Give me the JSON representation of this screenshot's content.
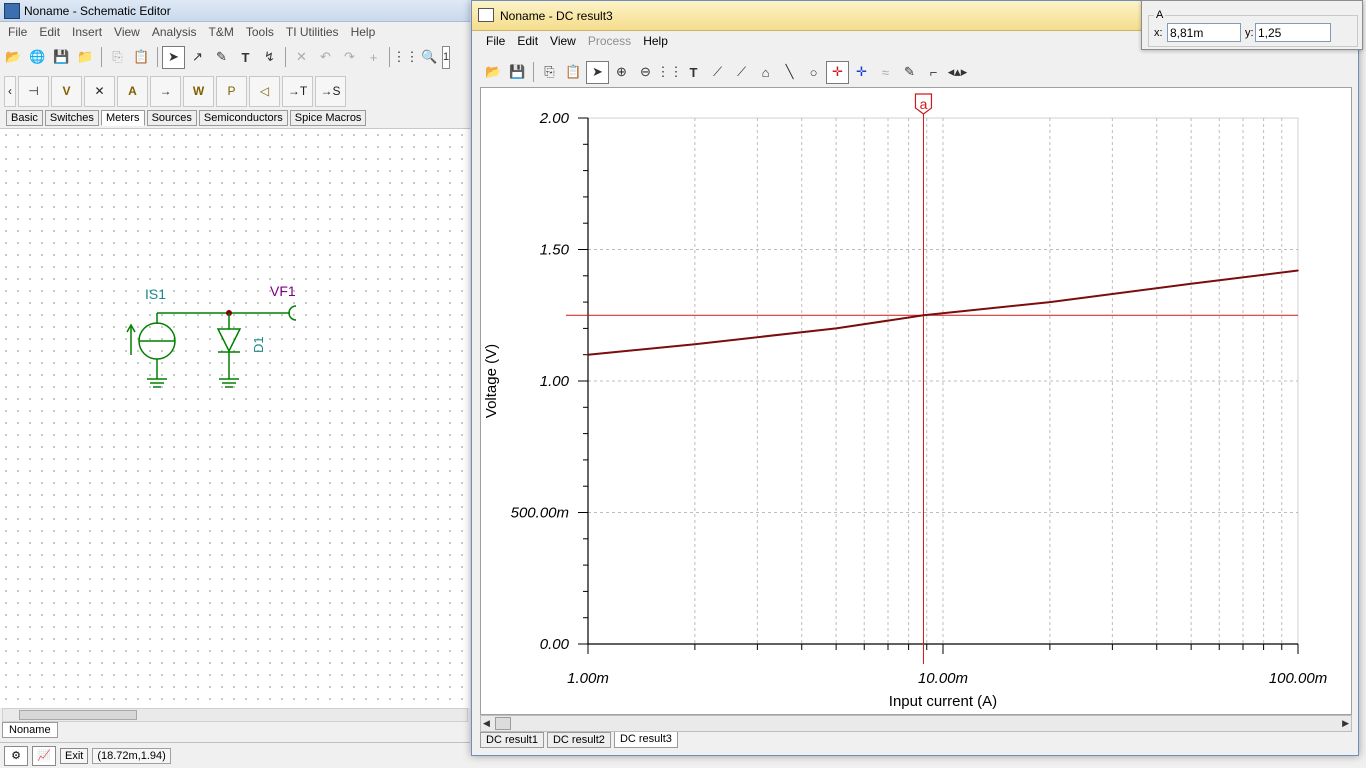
{
  "schematic": {
    "title": "Noname - Schematic Editor",
    "menu": [
      "File",
      "Edit",
      "Insert",
      "View",
      "Analysis",
      "T&M",
      "Tools",
      "TI Utilities",
      "Help"
    ],
    "zoom_partial": "1",
    "component_tabs": [
      {
        "label": "Basic",
        "selected": false
      },
      {
        "label": "Switches",
        "selected": false
      },
      {
        "label": "Meters",
        "selected": true
      },
      {
        "label": "Sources",
        "selected": false
      },
      {
        "label": "Semiconductors",
        "selected": false
      },
      {
        "label": "Spice Macros",
        "selected": false
      }
    ],
    "meter_buttons": [
      "⊣",
      "V",
      "✕",
      "A",
      "→",
      "W",
      "P",
      "◁",
      "→T",
      "→S"
    ],
    "circuit": {
      "source_label": "IS1",
      "diode_label": "D1",
      "probe_label": "VF1",
      "wire_color": "#008000",
      "label_color_source": "#1a8a8a",
      "label_color_probe": "#800080"
    },
    "doc_tab": "Noname",
    "status": {
      "exit_label": "Exit",
      "coordinates": "(18.72m,1.94)"
    }
  },
  "dc_result": {
    "title": "Noname - DC result3",
    "menu": [
      {
        "label": "File",
        "disabled": false
      },
      {
        "label": "Edit",
        "disabled": false
      },
      {
        "label": "View",
        "disabled": false
      },
      {
        "label": "Process",
        "disabled": true
      },
      {
        "label": "Help",
        "disabled": false
      }
    ],
    "result_tabs": [
      {
        "label": "DC result1",
        "selected": false
      },
      {
        "label": "DC result2",
        "selected": false
      },
      {
        "label": "DC result3",
        "selected": true
      }
    ]
  },
  "cursor_readout": {
    "cursor_name": "A",
    "x_label": "x:",
    "x_value": "8,81m",
    "y_label": "y:",
    "y_value": "1,25"
  },
  "chart_data": {
    "type": "line",
    "title": "",
    "xlabel": "Input current (A)",
    "ylabel": "Voltage (V)",
    "x_scale": "log",
    "xlim": [
      0.001,
      0.1
    ],
    "ylim": [
      0,
      2
    ],
    "x_tick_labels": [
      {
        "value": 0.001,
        "label": "1.00m"
      },
      {
        "value": 0.01,
        "label": "10.00m"
      },
      {
        "value": 0.1,
        "label": "100.00m"
      }
    ],
    "y_tick_labels": [
      {
        "value": 0,
        "label": "0.00"
      },
      {
        "value": 0.5,
        "label": "500.00m"
      },
      {
        "value": 1.0,
        "label": "1.00"
      },
      {
        "value": 1.5,
        "label": "1.50"
      },
      {
        "value": 2.0,
        "label": "2.00"
      }
    ],
    "grid": true,
    "series": [
      {
        "color": "#7a0d0d",
        "x": [
          0.001,
          0.002,
          0.005,
          0.00881,
          0.02,
          0.05,
          0.1
        ],
        "y": [
          1.1,
          1.14,
          1.2,
          1.25,
          1.3,
          1.37,
          1.42
        ]
      }
    ],
    "cursor": {
      "label": "a",
      "x": 0.00881,
      "y": 1.25,
      "color": "#d01818"
    }
  }
}
